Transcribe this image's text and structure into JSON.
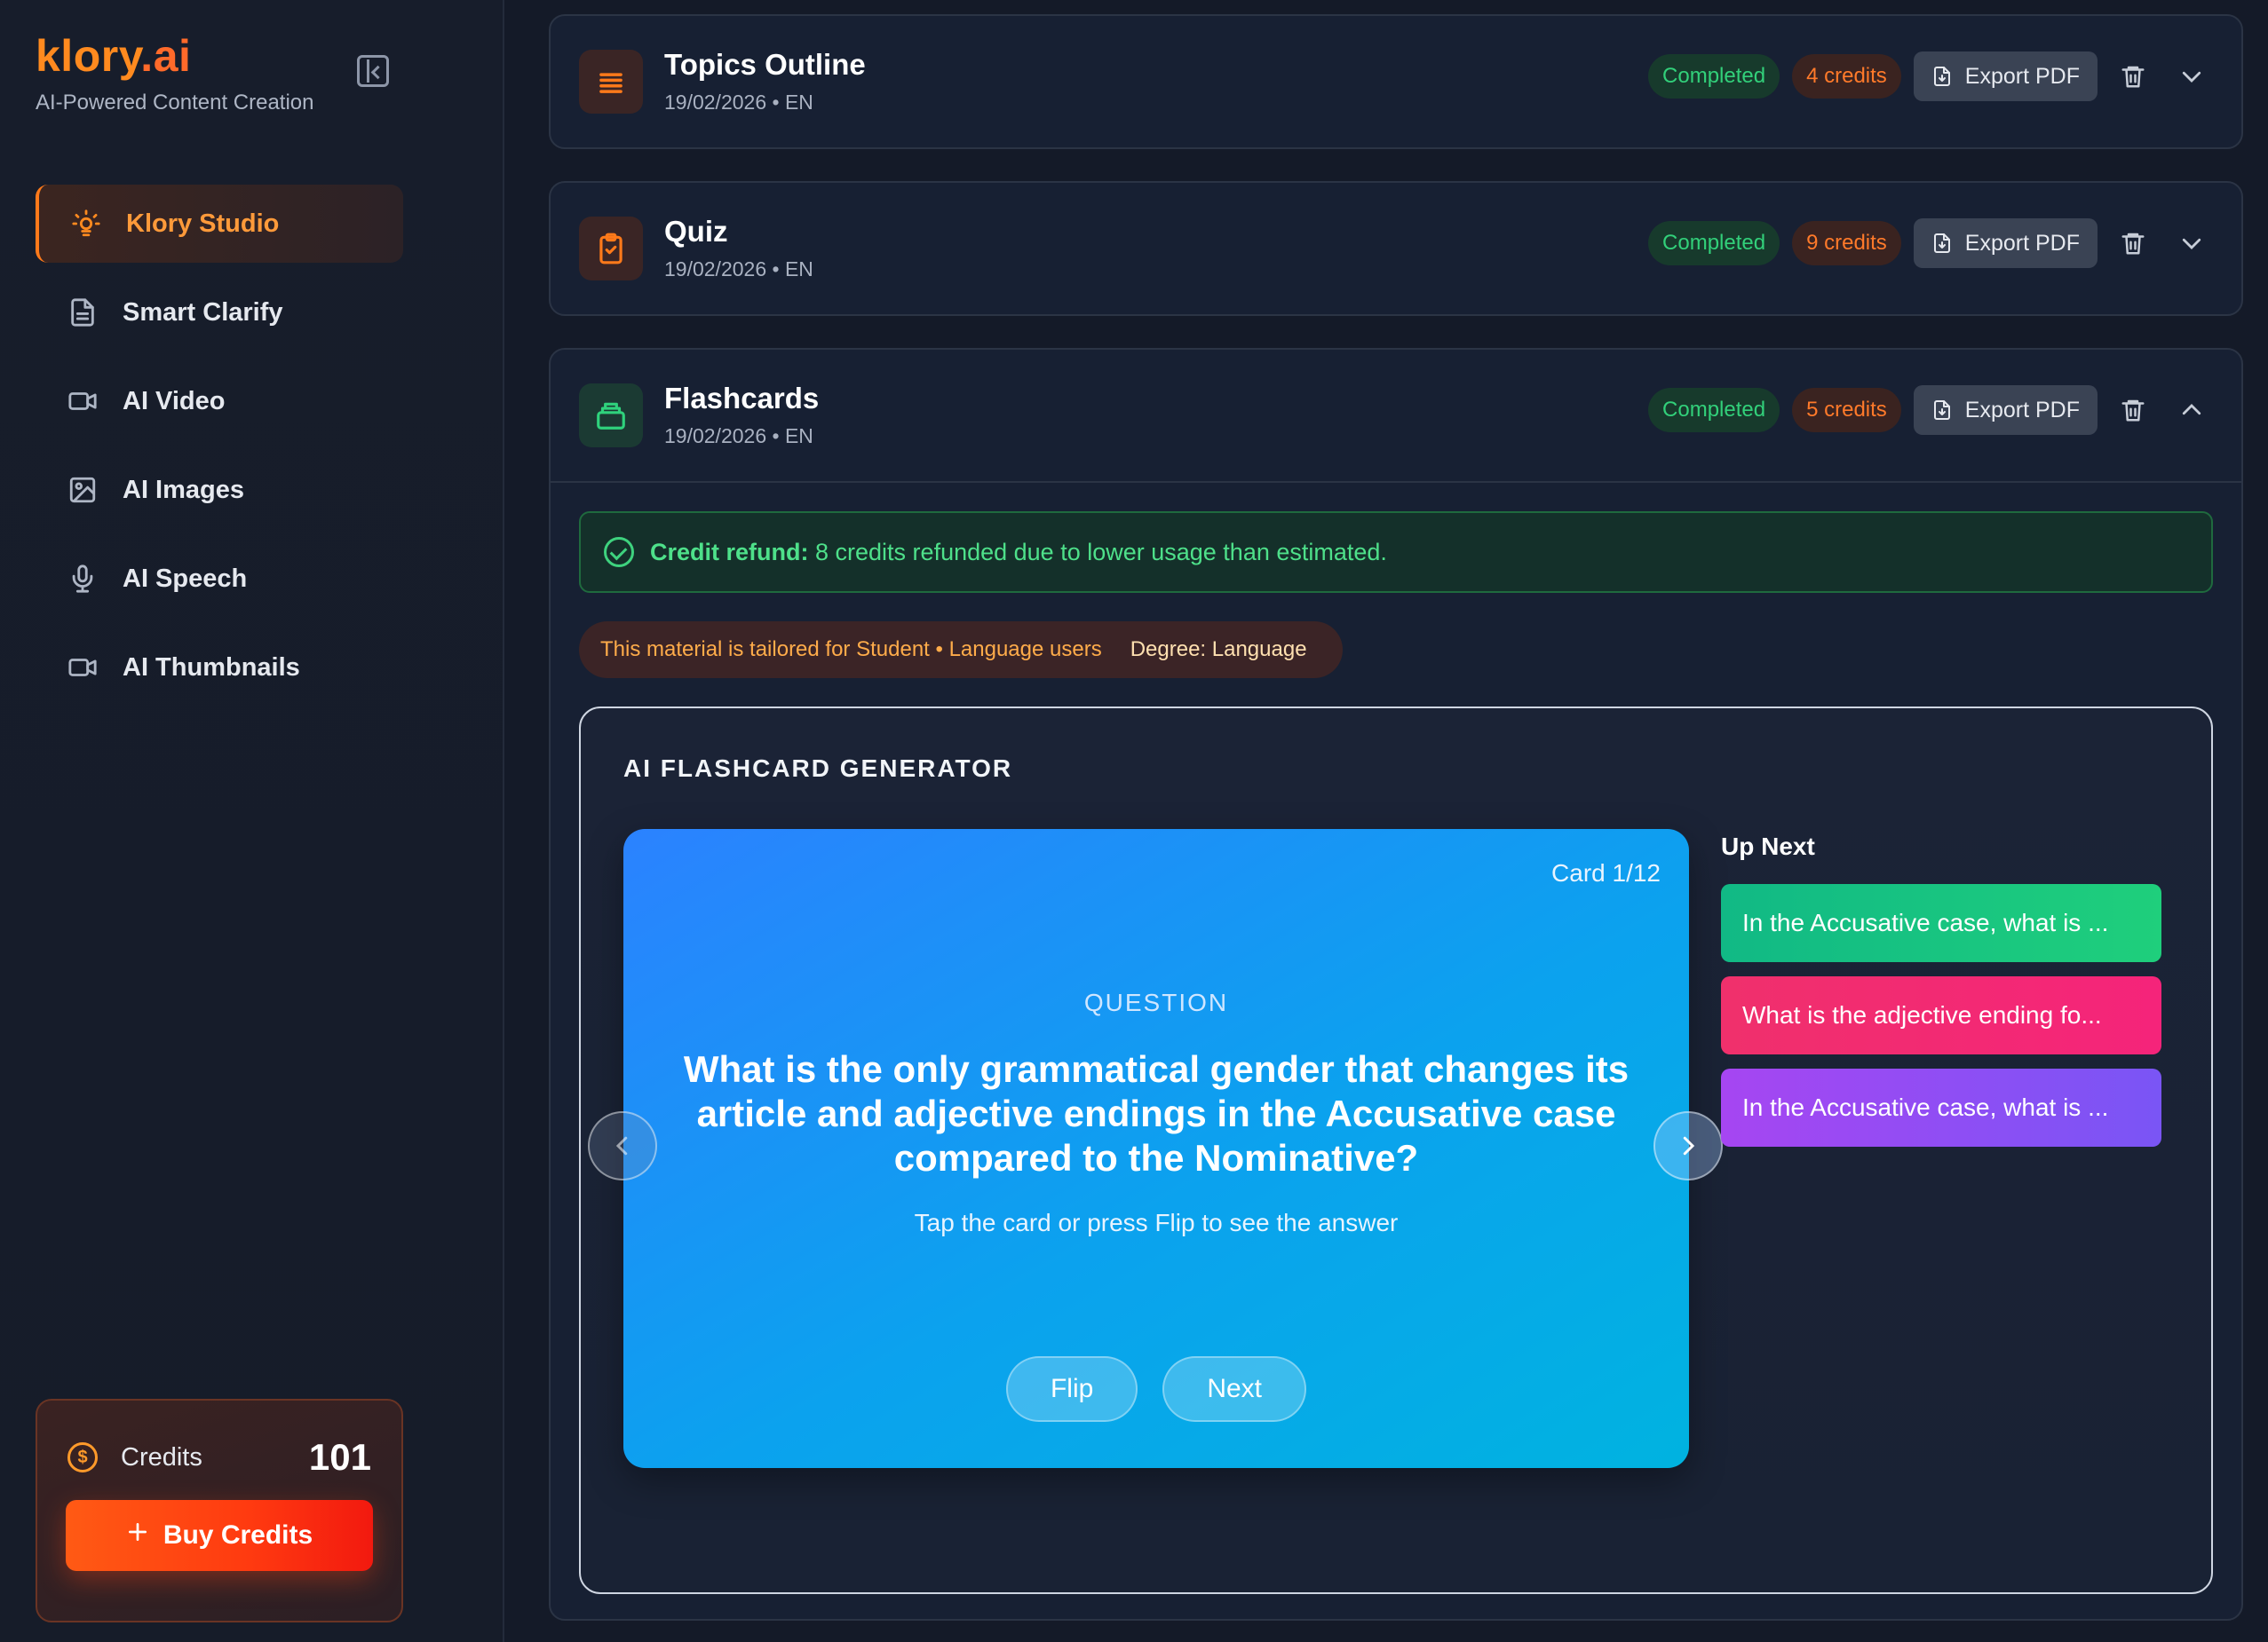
{
  "brand": {
    "name": "klory",
    "tld": ".ai",
    "subtitle": "AI-Powered Content Creation"
  },
  "sidebar": {
    "items": [
      {
        "label": "Klory Studio",
        "icon": "bulb-icon",
        "active": true
      },
      {
        "label": "Smart Clarify",
        "icon": "document-icon"
      },
      {
        "label": "AI Video",
        "icon": "video-icon"
      },
      {
        "label": "AI Images",
        "icon": "image-icon"
      },
      {
        "label": "AI Speech",
        "icon": "microphone-icon"
      },
      {
        "label": "AI Thumbnails",
        "icon": "video-icon"
      }
    ],
    "credits": {
      "label": "Credits",
      "value": "101",
      "buy_label": "Buy Credits"
    }
  },
  "items": [
    {
      "title": "Topics Outline",
      "meta": "19/02/2026 • EN",
      "status": "Completed",
      "credits": "4 credits",
      "export_label": "Export PDF",
      "icon": "list-icon"
    },
    {
      "title": "Quiz",
      "meta": "19/02/2026 • EN",
      "status": "Completed",
      "credits": "9 credits",
      "export_label": "Export PDF",
      "icon": "clipboard-check-icon"
    },
    {
      "title": "Flashcards",
      "meta": "19/02/2026 • EN",
      "status": "Completed",
      "credits": "5 credits",
      "export_label": "Export PDF",
      "icon": "cards-stack-icon"
    }
  ],
  "refund": {
    "label": "Credit refund:",
    "text": "8 credits refunded due to lower usage than estimated."
  },
  "tailor": {
    "text": "This material is tailored for Student • Language users",
    "degree": "Degree: Language"
  },
  "generator": {
    "title": "AI FLASHCARD GENERATOR",
    "card_count": "Card 1/12",
    "side_label": "QUESTION",
    "question": "What is the only grammatical gender that changes its article and adjective endings in the Accusative case compared to the Nominative?",
    "hint": "Tap the card or press Flip to see the answer",
    "flip_label": "Flip",
    "next_label": "Next",
    "up_next_title": "Up Next",
    "up_next": [
      "In the Accusative case, what is ...",
      "What is the adjective ending fo...",
      "In the Accusative case, what is ..."
    ]
  },
  "colors": {
    "accent": "#ff7a1a",
    "success": "#32d07a",
    "card": "#1a8ff5"
  }
}
